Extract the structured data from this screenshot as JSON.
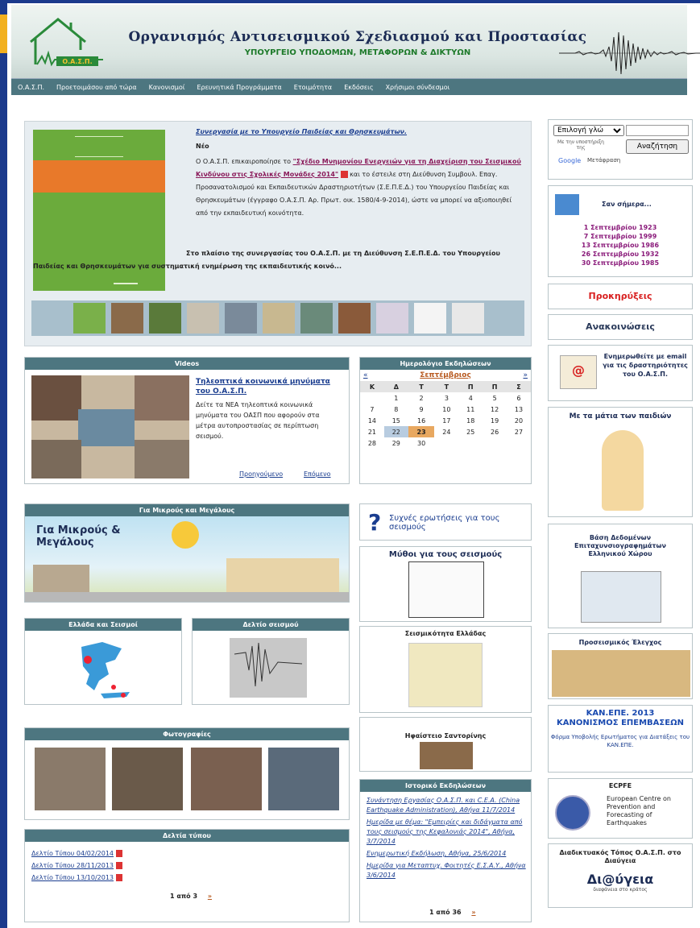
{
  "header": {
    "org_title": "Οργανισμός Αντισεισμικού Σχεδιασμού και Προστασίας",
    "ministry": "ΥΠΟΥΡΓΕΙΟ ΥΠΟΔΟΜΩΝ, ΜΕΤΑΦΟΡΩΝ & ΔΙΚΤΥΩΝ",
    "logo_text": "Ο.Α.Σ.Π."
  },
  "nav": [
    "Ο.Α.Σ.Π.",
    "Προετοιμάσου από τώρα",
    "Κανονισμοί",
    "Ερευνητικά Προγράμματα",
    "Ετοιμότητα",
    "Εκδόσεις",
    "Χρήσιμοι σύνδεσμοι"
  ],
  "featured": {
    "title": "Συνεργασία με το Υπουργείο Παιδείας και Θρησκευμάτων.",
    "tag": "Νέο",
    "text_pre": "Ο Ο.Α.Σ.Π. επικαιροποίησε το ",
    "link": "\"Σχέδιο Μνημονίου Ενεργειών για τη Διαχείριση του Σεισμικού Κινδύνου στις Σχολικές Μονάδες 2014\"",
    "text_post": " και το έστειλε στη Διεύθυνση Συμβουλ. Επαγ. Προσανατολισμού και Εκπαιδευτικών Δραστηριοτήτων (Σ.Ε.Π.Ε.Δ.)  του Υπουργείου Παιδείας και Θρησκευμάτων (έγγραφο Ο.Α.Σ.Π. Αρ. Πρωτ. οικ. 1580/4-9-2014), ώστε να μπορεί να αξιοποιηθεί από την εκπαιδευτική κοινότητα.",
    "text2": "Στο πλαίσιο της συνεργασίας του Ο.Α.Σ.Π. με τη Διεύθυνση Σ.Ε.Π.Ε.Δ. του Υπουργείου Παιδείας και Θρησκευμάτων για συστηματική ενημέρωση της εκπαιδευτικής κοινό..."
  },
  "videos": {
    "bar": "Videos",
    "link": "Τηλεοπτικά κοινωνικά μηνύματα του Ο.Α.Σ.Π.",
    "text": "Δείτε τα ΝΕΑ τηλεοπτικά κοινωνικά μηνύματα του ΟΑΣΠ που αφορούν στα μέτρα αυτοπροστασίας σε περίπτωση σεισμού.",
    "prev": "Προηγούμενο",
    "next": "Επόμενο"
  },
  "calendar": {
    "bar": "Ημερολόγιο Εκδηλώσεων",
    "month": "Σεπτέμβριος",
    "prev": "«",
    "next": "»",
    "days": [
      "Κ",
      "Δ",
      "Τ",
      "Τ",
      "Π",
      "Π",
      "Σ"
    ],
    "weeks": [
      [
        "",
        "1",
        "2",
        "3",
        "4",
        "5",
        "6"
      ],
      [
        "7",
        "8",
        "9",
        "10",
        "11",
        "12",
        "13"
      ],
      [
        "14",
        "15",
        "16",
        "17",
        "18",
        "19",
        "20"
      ],
      [
        "21",
        "22",
        "23",
        "24",
        "25",
        "26",
        "27"
      ],
      [
        "28",
        "29",
        "30",
        "",
        "",
        "",
        ""
      ]
    ],
    "today": "23",
    "selected": "22"
  },
  "kids": {
    "bar": "Για Μικρούς και Μεγάλους",
    "banner": "Για Μικρούς & Μεγάλους"
  },
  "greece": {
    "bar": "Ελλάδα και Σεισμοί"
  },
  "bulletin": {
    "bar": "Δελτίο σεισμού"
  },
  "photos": {
    "bar": "Φωτογραφίες"
  },
  "press": {
    "bar": "Δελτία τύπου",
    "items": [
      "Δελτίο Τύπου 04/02/2014",
      "Δελτίο Τύπου 28/11/2013",
      "Δελτίο Τύπου 13/10/2013"
    ],
    "pager": "1 από 3",
    "more": "»"
  },
  "faq": "Συχνές ερωτήσεις για τους σεισμούς",
  "myths": "Μύθοι για τους σεισμούς",
  "seismicity": "Σεισμικότητα Ελλάδας",
  "volcano": "Ηφαίστειο Σαντορίνης",
  "history": {
    "bar": "Ιστορικό Εκδηλώσεων",
    "items": [
      "Συνάντηση Εργασίας Ο.Α.Σ.Π. και C.E.A. (China Earthquake Administration), Αθήνα 11/7/2014",
      "Ημερίδα με θέμα: \"Εμπειρίες και διδάγματα από τους σεισμούς της Κεφαλονιάς 2014\", Αθήνα, 3/7/2014",
      "Ενημερωτική Εκδήλωση, Αθήνα, 25/6/2014",
      "Ημερίδα για Μεταπτυχ. Φοιτητές Ε.Σ.Α.Υ., Αθήνα 3/6/2014"
    ],
    "pager": "1 από 36",
    "more": "»"
  },
  "search": {
    "lang_select": "Επιλογή γλώ",
    "support_text": "Με την υποστήριξη της",
    "google": "Google",
    "translate": "Μετάφραση",
    "button": "Αναζήτηση"
  },
  "today": {
    "title": "Σαν σήμερα...",
    "items": [
      "1 Σεπτεμβρίου 1923",
      "7 Σεπτεμβρίου 1999",
      "13 Σεπτεμβρίου 1986",
      "26 Σεπτεμβρίου 1932",
      "30 Σεπτεμβρίου 1985"
    ]
  },
  "tenders": "Προκηρύξεις",
  "announcements": "Ανακοινώσεις",
  "email": "Ενημερωθείτε με email για τις δραστηριότητες του Ο.Α.Σ.Π.",
  "kids_eyes": "Με τα μάτια των παιδιών",
  "database": "Βάση Δεδομένων Επιταχυνσιογραφημάτων Ελληνικού Χώρου",
  "preseismic": "Προσεισμικός Έλεγχος",
  "kanepe": {
    "title": "ΚΑΝ.ΕΠΕ. 2013 ΚΑΝΟΝΙΣΜΟΣ ΕΠΕΜΒΑΣΕΩΝ",
    "link": "Φόρμα Υποβολής Ερωτήματος για Διατάξεις του ΚΑΝ.ΕΠΕ."
  },
  "ecpfe": {
    "title": "ECPFE",
    "text": "European Centre on Prevention and Forecasting of Earthquakes"
  },
  "diavgeia": {
    "title": "Διαδικτυακός Τόπος Ο.Α.Σ.Π. στο Διαύγεια",
    "logo": "Δι@ύγεια",
    "tagline": "διαφάνεια στο κράτος"
  }
}
